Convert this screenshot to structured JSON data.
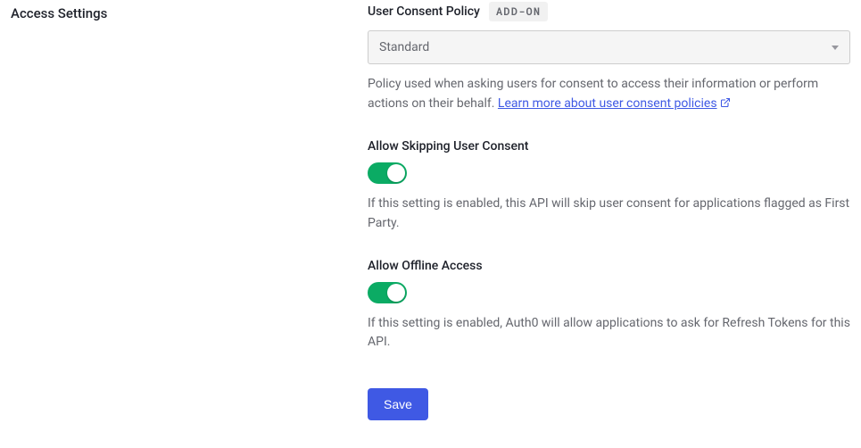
{
  "section_title": "Access Settings",
  "consent_policy": {
    "label": "User Consent Policy",
    "badge": "ADD-ON",
    "selected": "Standard",
    "helper": "Policy used when asking users for consent to access their information or perform actions on their behalf. ",
    "link_text": "Learn more about user consent policies"
  },
  "skip_consent": {
    "label": "Allow Skipping User Consent",
    "helper": "If this setting is enabled, this API will skip user consent for applications flagged as First Party."
  },
  "offline_access": {
    "label": "Allow Offline Access",
    "helper": "If this setting is enabled, Auth0 will allow applications to ask for Refresh Tokens for this API."
  },
  "save_label": "Save"
}
